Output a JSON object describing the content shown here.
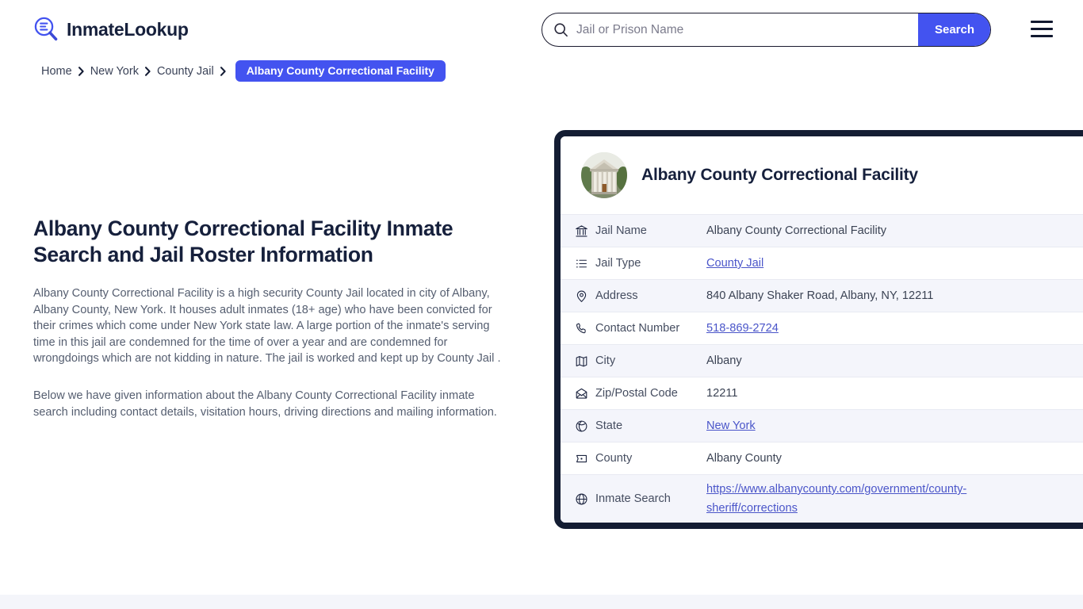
{
  "header": {
    "brand_name": "InmateLookup",
    "brand_icon": "magnifier-list-logo-icon",
    "search": {
      "placeholder": "Jail or Prison Name",
      "value": "",
      "button_label": "Search",
      "icon": "search-icon"
    },
    "menu_icon": "hamburger-menu-icon",
    "accent_color": "#4353f0"
  },
  "breadcrumb": {
    "items": [
      {
        "label": "Home"
      },
      {
        "label": "New York"
      },
      {
        "label": "County Jail"
      }
    ],
    "current": "Albany County Correctional Facility"
  },
  "article": {
    "heading": "Albany County Correctional Facility Inmate Search and Jail Roster Information",
    "paragraph_1": "Albany County Correctional Facility is a high security County Jail located in city of Albany, Albany County, New York. It houses adult inmates (18+ age) who have been convicted for their crimes which come under New York state law. A large portion of the inmate's serving time in this jail are condemned for the time of over a year and are condemned for wrongdoings which are not kidding in nature. The jail is worked and kept up by County Jail .",
    "paragraph_2": "Below we have given information about the Albany County Correctional Facility inmate search including contact details, visitation hours, driving directions and mailing information."
  },
  "card": {
    "title": "Albany County Correctional Facility",
    "avatar_icon": "courthouse-building-photo",
    "border_color": "#141d33",
    "rows": [
      {
        "icon": "bank-building-icon",
        "label": "Jail Name",
        "value": "Albany County Correctional Facility",
        "link": false
      },
      {
        "icon": "list-icon",
        "label": "Jail Type",
        "value": "County Jail",
        "link": true
      },
      {
        "icon": "map-pin-icon",
        "label": "Address",
        "value": "840 Albany Shaker Road, Albany, NY, 12211",
        "link": false
      },
      {
        "icon": "phone-icon",
        "label": "Contact Number",
        "value": "518-869-2724",
        "link": true
      },
      {
        "icon": "map-icon",
        "label": "City",
        "value": "Albany",
        "link": false
      },
      {
        "icon": "envelope-icon",
        "label": "Zip/Postal Code",
        "value": "12211",
        "link": false
      },
      {
        "icon": "globe-americas-icon",
        "label": "State",
        "value": "New York",
        "link": true
      },
      {
        "icon": "county-flag-icon",
        "label": "County",
        "value": "Albany County",
        "link": false
      },
      {
        "icon": "globe-icon",
        "label": "Inmate Search",
        "value": "https://www.albanycounty.com/government/county-sheriff/corrections",
        "link": true
      }
    ]
  }
}
